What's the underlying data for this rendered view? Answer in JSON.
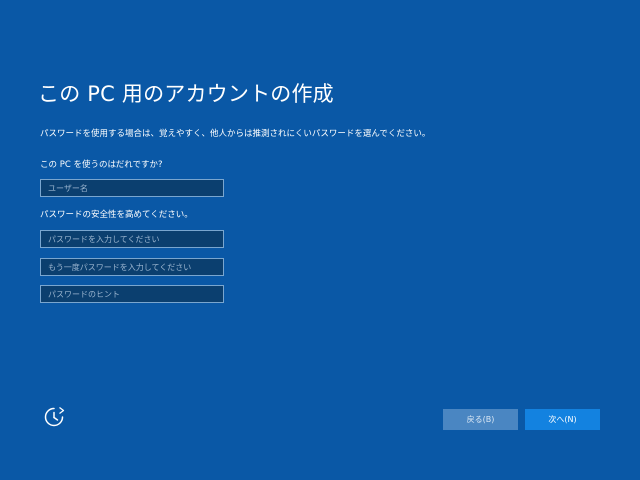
{
  "page": {
    "title": "この PC 用のアカウントの作成",
    "description": "パスワードを使用する場合は、覚えやすく、他人からは推測されにくいパスワードを選んでください。"
  },
  "username": {
    "label": "この PC を使うのはだれですか?",
    "placeholder": "ユーザー名",
    "value": ""
  },
  "password": {
    "label": "パスワードの安全性を高めてください。",
    "password_placeholder": "パスワードを入力してください",
    "confirm_placeholder": "もう一度パスワードを入力してください",
    "hint_placeholder": "パスワードのヒント"
  },
  "footer": {
    "accessibility_icon": "ease-of-access-icon",
    "back_label": "戻る(B)",
    "next_label": "次へ(N)"
  },
  "colors": {
    "background": "#0a58a6",
    "field_background": "#0b3f6f",
    "field_border": "#7aa6cf",
    "back_button": "#4a86c2",
    "next_button": "#1382e0"
  }
}
